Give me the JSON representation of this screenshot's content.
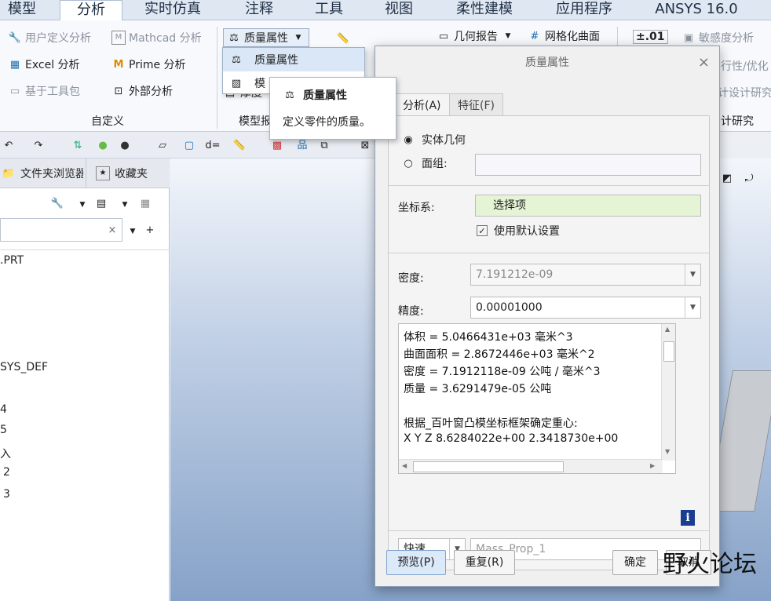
{
  "ribbon_tabs": [
    "模型",
    "分析",
    "实时仿真",
    "注释",
    "工具",
    "视图",
    "柔性建模",
    "应用程序",
    "ANSYS 16.0"
  ],
  "ribbon": {
    "custom_group": {
      "items": [
        "用户定义分析",
        "Mathcad 分析",
        "Excel 分析",
        "Prime 分析",
        "基于工具包",
        "外部分析"
      ],
      "label": "自定义"
    },
    "model_group": {
      "mass_props_button": "质量属性",
      "menu_items": [
        "质量属性",
        "模"
      ],
      "thickness": "厚度",
      "label": "模型报"
    },
    "geometry_report": "几何报告",
    "mesh_surface": "网格化曲面",
    "sensitivity": "敏感度分析",
    "feasibility": "行性/优化",
    "design_study": "计设计研究",
    "design_study_label": "计研究",
    "pm01": "±.01"
  },
  "tooltip": {
    "title": "质量属性",
    "desc": "定义零件的质量。"
  },
  "left_panel": {
    "tabs": [
      "文件夹浏览器",
      "收藏夹"
    ],
    "tree_items": [
      ".PRT",
      "SYS_DEF",
      "4",
      "5",
      "入",
      "2",
      "3"
    ]
  },
  "dialog": {
    "title": "质量属性",
    "close": "×",
    "tabs": [
      "分析(A)",
      "特征(F)"
    ],
    "solid_geometry": "实体几何",
    "quilt": "面组:",
    "coord_label": "坐标系:",
    "coord_value": "选择项",
    "use_default": "使用默认设置",
    "density_label": "密度:",
    "density_value": "7.191212e-09",
    "precision_label": "精度:",
    "precision_value": "0.00001000",
    "results": [
      "体积 =  5.0466431e+03  毫米^3",
      "曲面面积 =  2.8672446e+03  毫米^2",
      "密度 =  7.1912118e-09 公吨 / 毫米^3",
      "质量 =  3.6291479e-05 公吨",
      "",
      "根据_百叶窗凸模坐标框架确定重心:",
      "X  Y  Z    8.6284022e+00  2.3418730e+00"
    ],
    "mode": "快速",
    "name_value": "Mass_Prop_1",
    "preview": "预览(P)",
    "repeat": "重复(R)",
    "ok": "确定",
    "cancel": "取消"
  },
  "watermark": "野火论坛"
}
